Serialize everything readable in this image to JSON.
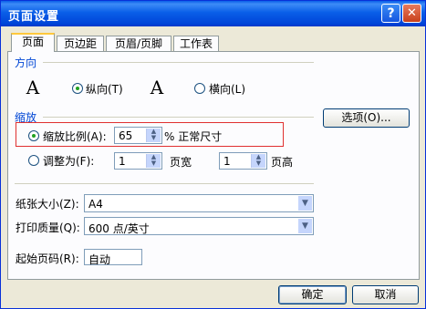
{
  "window": {
    "title": "页面设置",
    "help_icon": "?",
    "close_icon": "✕"
  },
  "tabs": [
    {
      "label": "页面",
      "active": true
    },
    {
      "label": "页边距",
      "active": false
    },
    {
      "label": "页眉/页脚",
      "active": false
    },
    {
      "label": "工作表",
      "active": false
    }
  ],
  "orientation": {
    "section": "方向",
    "portrait_icon": "A",
    "portrait_label": "纵向(T)",
    "landscape_icon": "A",
    "landscape_label": "横向(L)",
    "selected": "portrait"
  },
  "scaling": {
    "section": "缩放",
    "options_button": "选项(O)...",
    "scale_label": "缩放比例(A):",
    "scale_value": "65",
    "scale_suffix": "% 正常尺寸",
    "fit_label": "调整为(F):",
    "fit_wide_value": "1",
    "fit_wide_label": "页宽",
    "fit_tall_value": "1",
    "fit_tall_label": "页高",
    "selected": "scale"
  },
  "paper_size": {
    "label": "纸张大小(Z):",
    "value": "A4"
  },
  "print_quality": {
    "label": "打印质量(Q):",
    "value": "600 点/英寸"
  },
  "first_page": {
    "label": "起始页码(R):",
    "value": "自动"
  },
  "buttons": {
    "ok": "确定",
    "cancel": "取消"
  }
}
